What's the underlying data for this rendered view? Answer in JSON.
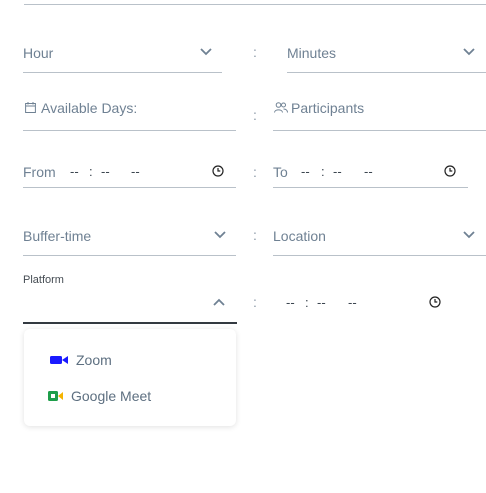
{
  "form": {
    "hour_placeholder": "Hour",
    "minutes_placeholder": "Minutes",
    "available_days_label": "Available Days:",
    "participants_label": "Participants",
    "from_label": "From",
    "to_label": "To",
    "time_placeholder": {
      "hh": "--",
      "sep": ":",
      "mm": "--",
      "ampm": "--"
    },
    "buffer_time_placeholder": "Buffer-time",
    "location_placeholder": "Location",
    "platform_label": "Platform",
    "colon": ":"
  },
  "platform_dropdown": {
    "options": [
      {
        "label": "Zoom",
        "icon": "zoom-video-icon",
        "color": "#1a1aff"
      },
      {
        "label": "Google Meet",
        "icon": "google-meet-icon",
        "color": "#1e9e4a"
      }
    ]
  },
  "colors": {
    "underline": "#b9c1c9",
    "focused_underline": "#333a41",
    "text": "#6f8193"
  }
}
